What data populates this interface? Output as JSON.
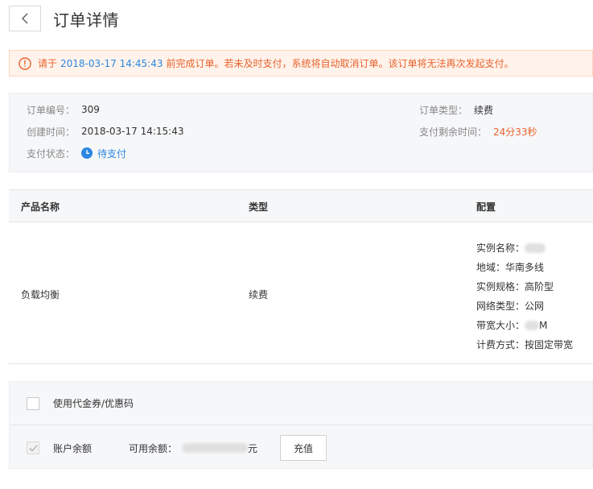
{
  "header": {
    "title": "订单详情"
  },
  "alert": {
    "prefix": "请于",
    "deadline": "2018-03-17 14:45:43",
    "suffix": "前完成订单。若未及时支付，系统将自动取消订单。该订单将无法再次发起支付。"
  },
  "info": {
    "order_no_label": "订单编号：",
    "order_no": "309",
    "created_label": "创建时间：",
    "created": "2018-03-17 14:15:43",
    "status_label": "支付状态：",
    "status": "待支付",
    "type_label": "订单类型：",
    "type": "续费",
    "remaining_label": "支付剩余时间：",
    "remaining": "24分33秒"
  },
  "table": {
    "columns": [
      "产品名称",
      "类型",
      "配置"
    ],
    "row": {
      "product": "负载均衡",
      "type": "续费",
      "specs": [
        {
          "label": "实例名称：",
          "value": ""
        },
        {
          "label": "地域：",
          "value": "华南多线"
        },
        {
          "label": "实例规格：",
          "value": "高阶型"
        },
        {
          "label": "网络类型：",
          "value": "公网"
        },
        {
          "label": "带宽大小：",
          "value": "M"
        },
        {
          "label": "计费方式：",
          "value": "按固定带宽"
        }
      ]
    }
  },
  "payment": {
    "coupon_label": "使用代金券/优惠码",
    "balance_label": "账户余额",
    "available_label": "可用余额：",
    "currency_unit": "元",
    "recharge_label": "充值"
  },
  "colors": {
    "accent": "#2b87e0",
    "warning": "#e9622d",
    "panel_bg": "#f6f7f9"
  }
}
